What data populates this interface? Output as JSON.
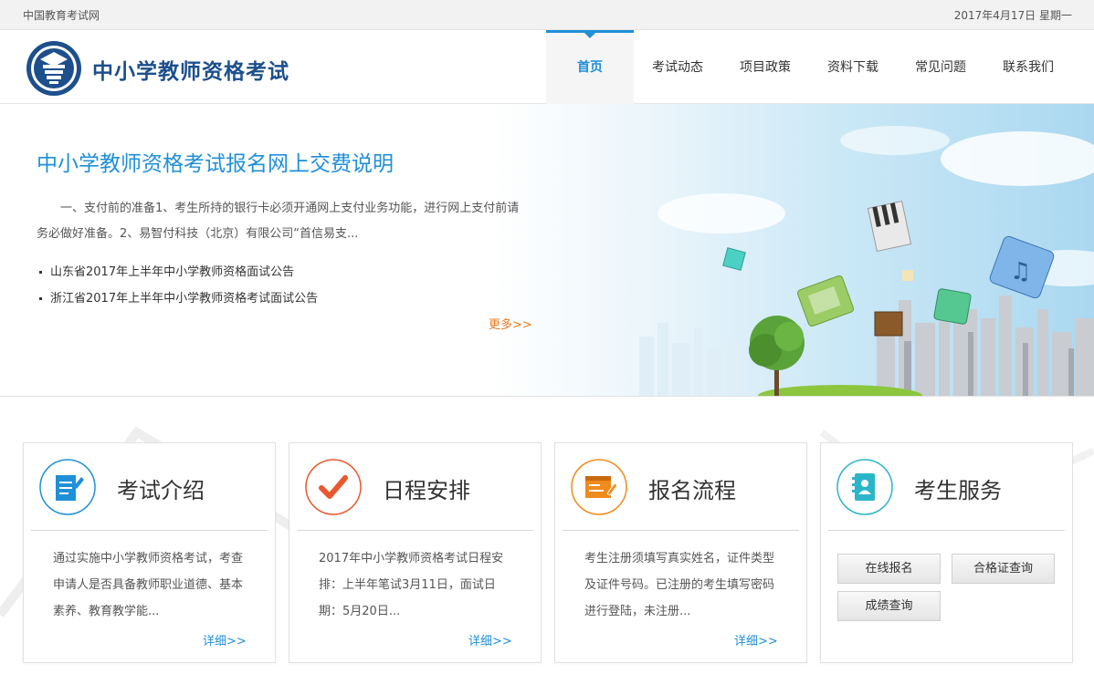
{
  "topbar": {
    "site": "中国教育考试网",
    "date": "2017年4月17日 星期一"
  },
  "header": {
    "title": "中小学教师资格考试"
  },
  "nav": [
    {
      "label": "首页",
      "active": true
    },
    {
      "label": "考试动态"
    },
    {
      "label": "项目政策"
    },
    {
      "label": "资料下载"
    },
    {
      "label": "常见问题"
    },
    {
      "label": "联系我们"
    }
  ],
  "banner": {
    "title": "中小学教师资格考试报名网上交费说明",
    "desc": "一、支付前的准备1、考生所持的银行卡必须开通网上支付业务功能，进行网上支付前请务必做好准备。2、易智付科技（北京）有限公司“首信易支...",
    "news": [
      "山东省2017年上半年中小学教师资格面试公告",
      "浙江省2017年上半年中小学教师资格考试面试公告"
    ],
    "more": "更多>>"
  },
  "cards": [
    {
      "title": "考试介绍",
      "icon": "document-pen-icon",
      "color": "#1f8fd8",
      "body": "通过实施中小学教师资格考试，考查申请人是否具备教师职业道德、基本素养、教育教学能...",
      "more": "详细>>"
    },
    {
      "title": "日程安排",
      "icon": "checkmark-icon",
      "color": "#e8582f",
      "body": "2017年中小学教师资格考试日程安排：上半年笔试3月11日，面试日期：5月20日...",
      "more": "详细>>"
    },
    {
      "title": "报名流程",
      "icon": "form-edit-icon",
      "color": "#f08a1c",
      "body": "考生注册须填写真实姓名，证件类型及证件号码。已注册的考生填写密码进行登陆，未注册...",
      "more": "详细>>"
    },
    {
      "title": "考生服务",
      "icon": "id-card-icon",
      "color": "#2bb5c9",
      "buttons": [
        "在线报名",
        "合格证查询",
        "成绩查询"
      ]
    }
  ]
}
